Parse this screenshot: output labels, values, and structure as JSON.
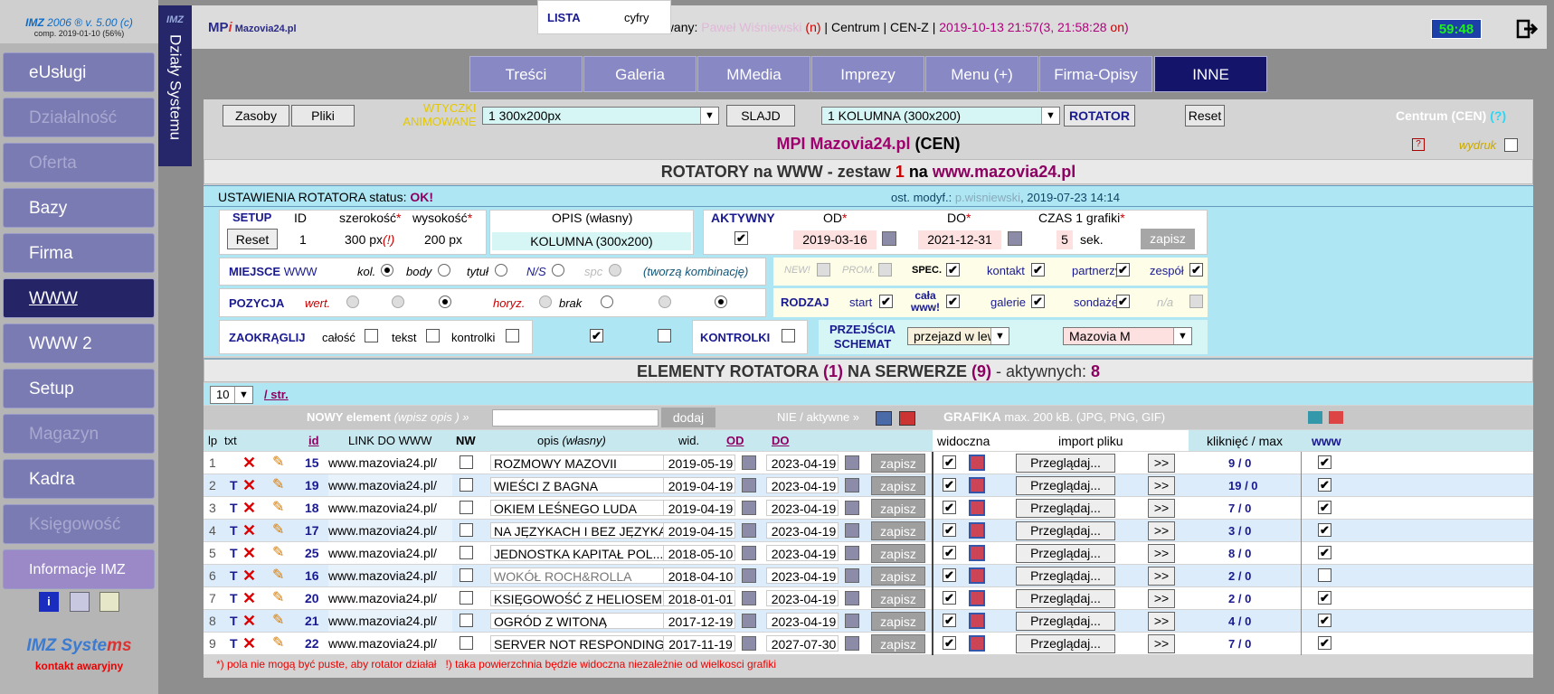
{
  "brand": {
    "line1": "IMZ",
    "line1b": "2006 ® v. 5.00 (c)",
    "line2": "comp. 2019-01-10 (56%)"
  },
  "sidebar": {
    "items": [
      {
        "label": "eUsługi",
        "state": "normal"
      },
      {
        "label": "Działalność",
        "state": "dim"
      },
      {
        "label": "Oferta",
        "state": "dim"
      },
      {
        "label": "Bazy",
        "state": "normal"
      },
      {
        "label": "Firma",
        "state": "normal"
      },
      {
        "label": "WWW",
        "state": "active"
      },
      {
        "label": "WWW 2",
        "state": "normal"
      },
      {
        "label": "Setup",
        "state": "normal"
      },
      {
        "label": "Magazyn",
        "state": "dim"
      },
      {
        "label": "Kadra",
        "state": "normal"
      },
      {
        "label": "Księgowość",
        "state": "dim"
      },
      {
        "label": "Informacje IMZ",
        "state": "info"
      }
    ],
    "logo_a": "IMZ Syste",
    "logo_b": "ms",
    "contact": "kontakt awaryjny"
  },
  "vstrip": {
    "imz": "IMZ",
    "title": "Działy Systemu"
  },
  "topbar": {
    "logo_a": "MP",
    "logo_b": "i",
    "logo_c": " Mazovia24.pl",
    "login_label": "Zalogowany:",
    "login_name": "Paweł Wiśniewski",
    "login_n": "(n)",
    "login_mid": " | Centrum | CEN-Z | ",
    "login_date": "2019-10-13 21:57(3, 21:58:28 ",
    "login_on": "on",
    ")": ")",
    "clock": "59:48"
  },
  "tabs": [
    {
      "label": "Treści"
    },
    {
      "label": "Galeria"
    },
    {
      "label": "MMedia"
    },
    {
      "label": "Imprezy"
    },
    {
      "label": "Menu (+)"
    },
    {
      "label": "Firma-Opisy"
    },
    {
      "label": "INNE"
    }
  ],
  "toolbar": {
    "zasoby": "Zasoby",
    "pliki": "Pliki",
    "wtyczki": "WTYCZKI",
    "animowane": "ANIMOWANE",
    "sel1": "1 300x200px",
    "slajd": "SLAJD",
    "sel2": "1 KOLUMNA (300x200)",
    "rotator": "ROTATOR",
    "reset": "Reset",
    "centrum": "Centrum (CEN)",
    "centrum_q": "(?)"
  },
  "title_bar": {
    "a": "MPI Mazovia24.pl",
    "b": " (CEN)",
    "wydruk": "wydruk"
  },
  "rot_title": {
    "a": "ROTATORY na WWW - zestaw ",
    "b": "1",
    "c": " na ",
    "d": "www.mazovia24.pl"
  },
  "status": {
    "label": "USTAWIENIA ROTATORA status: ",
    "ok": "OK!",
    "mod_a": "ost. modyf.: ",
    "mod_name": "p.wisniewski",
    "mod_b": ", 2019-07-23 14:14"
  },
  "setup": {
    "setup": "SETUP",
    "id": "ID",
    "szer": "szerokość",
    "wys": "wysokość",
    "opis": "OPIS (własny)",
    "aktywny": "AKTYWNY",
    "od": "OD",
    "do": "DO",
    "czas": "CZAS 1 grafiki",
    "star": "*",
    "reset": "Reset",
    "id_val": "1",
    "szer_val": "300",
    "px": "px",
    "px_warn": "(!)",
    "wys_val": "200",
    "opis_val": "KOLUMNA (300x200)",
    "od_val": "2019-03-16",
    "do_val": "2021-12-31",
    "czas_val": "5",
    "sek": "sek.",
    "zapisz": "zapisz"
  },
  "miejsce": {
    "label": "MIEJSCE",
    "www": "WWW",
    "kol": "kol.",
    "body": "body",
    "tytul": "tytuł",
    "ns": "N/S",
    "spc": "spc",
    "note": "(tworzą kombinację)"
  },
  "pozycja": {
    "label": "POZYCJA",
    "wert": "wert.",
    "horyz": "horyz.",
    "brak": "brak"
  },
  "zaokr": {
    "label": "ZAOKRĄGLIJ",
    "calosc": "całość",
    "tekst": "tekst",
    "kontrolki": "kontrolki",
    "lista": "LISTA",
    "cyfry": "cyfry",
    "kontrolki2": "KONTROLKI",
    "przejscia": "PRZEJŚCIA",
    "schemat": "SCHEMAT",
    "przejazd": "przejazd w lewo",
    "mazovia": "Mazovia M"
  },
  "flags": {
    "new": "NEW!",
    "prom": "PROM.",
    "spec": "SPEC.",
    "kontakt": "kontakt",
    "partnerzy": "partnerzy",
    "zespol": "zespół",
    "rodzaj": "RODZAJ",
    "start": "start",
    "cala": "cała",
    "www": "www!",
    "galerie": "galerie",
    "sondaze": "sondaże",
    "na": "n/a"
  },
  "elements_title": {
    "a": "ELEMENTY ROTATORA ",
    "b": "(1)",
    "c": " NA SERWERZE ",
    "d": "(9)",
    "e": " - aktywnych: ",
    "f": "8"
  },
  "paging": {
    "per": "10",
    "str": "/ str."
  },
  "newrow": {
    "nowy": "NOWY element",
    "wpisz": " (wpisz opis ) »",
    "dodaj": "dodaj",
    "nie": "NIE / aktywne »",
    "grafika": "GRAFIKA",
    "max": " max. 200 kB. (JPG, PNG, GIF)"
  },
  "cols": {
    "lp": "lp",
    "txt": "txt",
    "id": "id",
    "link": "LINK DO WWW",
    "nw": "NW",
    "opis": "opis",
    "wlasny": " (własny)",
    "wid": "wid.",
    "od": "OD",
    "do": "DO",
    "widoczna": "widoczna",
    "import": "import pliku",
    "klik": "kliknięć / max",
    "www": "www"
  },
  "rows": [
    {
      "lp": "1",
      "t": "",
      "id": "15",
      "link": "www.mazovia24.pl/",
      "opis": "ROZMOWY MAZOVII",
      "od": "2019-05-19",
      "do": "2023-04-19",
      "klik": "9 / 0",
      "www": true,
      "dim": false
    },
    {
      "lp": "2",
      "t": "T",
      "id": "19",
      "link": "www.mazovia24.pl/",
      "opis": "WIEŚCI Z BAGNA",
      "od": "2019-04-19",
      "do": "2023-04-19",
      "klik": "19 / 0",
      "www": true,
      "dim": false
    },
    {
      "lp": "3",
      "t": "T",
      "id": "18",
      "link": "www.mazovia24.pl/",
      "opis": "OKIEM LEŚNEGO LUDA",
      "od": "2019-04-19",
      "do": "2023-04-19",
      "klik": "7 / 0",
      "www": true,
      "dim": false
    },
    {
      "lp": "4",
      "t": "T",
      "id": "17",
      "link": "www.mazovia24.pl/",
      "opis": "NA JĘZYKACH I BEZ JĘZYKA",
      "od": "2019-04-15",
      "do": "2023-04-19",
      "klik": "3 / 0",
      "www": true,
      "dim": false
    },
    {
      "lp": "5",
      "t": "T",
      "id": "25",
      "link": "www.mazovia24.pl/",
      "opis": "JEDNOSTKA KAPITAŁ POL...",
      "od": "2018-05-10",
      "do": "2023-04-19",
      "klik": "8 / 0",
      "www": true,
      "dim": false
    },
    {
      "lp": "6",
      "t": "T",
      "id": "16",
      "link": "www.mazovia24.pl/",
      "opis": "WOKÓŁ ROCH&ROLLA",
      "od": "2018-04-10",
      "do": "2023-04-19",
      "klik": "2 / 0",
      "www": false,
      "dim": true
    },
    {
      "lp": "7",
      "t": "T",
      "id": "20",
      "link": "www.mazovia24.pl/",
      "opis": "KSIĘGOWOŚĆ Z HELIOSEM",
      "od": "2018-01-01",
      "do": "2023-04-19",
      "klik": "2 / 0",
      "www": true,
      "dim": false
    },
    {
      "lp": "8",
      "t": "T",
      "id": "21",
      "link": "www.mazovia24.pl/",
      "opis": "OGRÓD Z WITONĄ",
      "od": "2017-12-19",
      "do": "2023-04-19",
      "klik": "4 / 0",
      "www": true,
      "dim": false
    },
    {
      "lp": "9",
      "t": "T",
      "id": "22",
      "link": "www.mazovia24.pl/",
      "opis": "SERVER NOT RESPONDING",
      "od": "2017-11-19",
      "do": "2027-07-30",
      "klik": "7 / 0",
      "www": true,
      "dim": false
    }
  ],
  "row_labels": {
    "zapisz": "zapisz",
    "przegladaj": "Przeglądaj...",
    "go": ">>"
  },
  "footnote": "*) pola nie mogą być puste, aby rotator działał   !) taka powierzchnia będzie widoczna niezależnie od wielkosci grafiki"
}
